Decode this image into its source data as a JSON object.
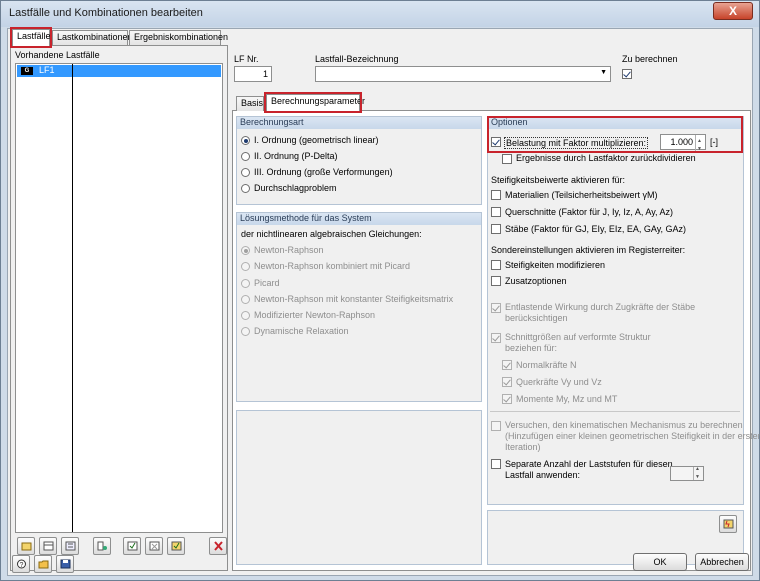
{
  "window": {
    "title": "Lastfälle und Kombinationen bearbeiten",
    "close": "X"
  },
  "tabs_top": [
    "Lastfälle",
    "Lastkombinationen",
    "Ergebniskombinationen"
  ],
  "left": {
    "header": "Vorhandene Lastfälle",
    "items": [
      {
        "badge": "G",
        "label": "LF1"
      }
    ]
  },
  "lf_nr": {
    "label": "LF Nr.",
    "value": "1"
  },
  "bezeichnung": {
    "label": "Lastfall-Bezeichnung",
    "value": ""
  },
  "zu_berechnen": {
    "label": "Zu berechnen",
    "checked": true
  },
  "subtabs": [
    "Basis",
    "Berechnungsparameter"
  ],
  "berechnungsart": {
    "head": "Berechnungsart",
    "options": [
      "I. Ordnung (geometrisch linear)",
      "II. Ordnung (P-Delta)",
      "III. Ordnung (große Verformungen)",
      "Durchschlagproblem"
    ]
  },
  "loesung": {
    "head": "Lösungsmethode für das System",
    "sub": "der nichtlinearen algebraischen Gleichungen:",
    "options": [
      "Newton-Raphson",
      "Newton-Raphson kombiniert mit Picard",
      "Picard",
      "Newton-Raphson mit konstanter Steifigkeitsmatrix",
      "Modifizierter Newton-Raphson",
      "Dynamische Relaxation"
    ]
  },
  "optionen": {
    "head": "Optionen",
    "faktor_label": "Belastung mit Faktor multiplizieren:",
    "faktor_value": "1.000",
    "faktor_unit": "[-]",
    "ergebnisse": "Ergebnisse durch Lastfaktor zurückdividieren",
    "steif_head": "Steifigkeitsbeiwerte aktivieren für:",
    "materialien": "Materialien (Teilsicherheitsbeiwert γM)",
    "querschnitte": "Querschnitte (Faktor für J, Iy, Iz, A, Ay, Az)",
    "staebe": "Stäbe (Faktor für GJ, EIy, EIz, EA, GAy, GAz)",
    "sonder_head": "Sondereinstellungen aktivieren im Registerreiter:",
    "steif_mod": "Steifigkeiten modifizieren",
    "zusatz": "Zusatzoptionen",
    "entlastend1": "Entlastende Wirkung durch Zugkräfte der Stäbe",
    "entlastend2": "berücksichtigen",
    "schnitt1": "Schnittgrößen auf verformte Struktur",
    "schnitt2": "beziehen für:",
    "normal": "Normalkräfte N",
    "quer": "Querkräfte Vy und Vz",
    "momente": "Momente My, Mz und MT",
    "versuch1": "Versuchen, den kinematischen Mechanismus zu berechnen",
    "versuch2": "(Hinzufügen einer kleinen geometrischen Steifigkeit in der ersten",
    "versuch3": "Iteration)",
    "separat1": "Separate Anzahl der Laststufen für diesen",
    "separat2": "Lastfall anwenden:"
  },
  "buttons": {
    "ok": "OK",
    "cancel": "Abbrechen"
  }
}
